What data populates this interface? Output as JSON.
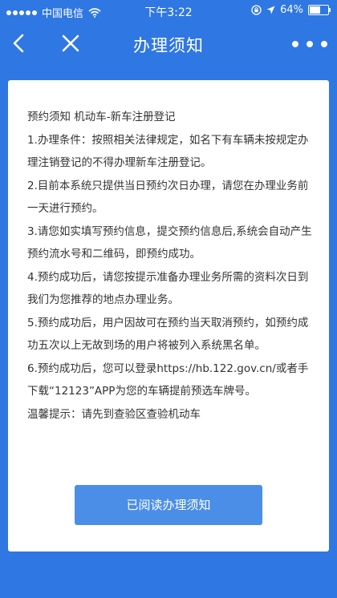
{
  "status_bar": {
    "carrier": "中国电信",
    "time": "下午3:22",
    "battery_percent": "64%",
    "battery_level": 0.64,
    "icons": [
      "signal-dots-icon",
      "wifi-icon",
      "orientation-lock-icon",
      "location-icon",
      "battery-icon"
    ]
  },
  "nav": {
    "title": "办理须知",
    "icons": [
      "back-arrow-icon",
      "close-icon",
      "more-icon"
    ]
  },
  "notice": {
    "heading": "预约须知 机动车-新车注册登记",
    "items": [
      "1.办理条件：按照相关法律规定，如名下有车辆未按规定办理注销登记的不得办理新车注册登记。",
      "2.目前本系统只提供当日预约次日办理，请您在办理业务前一天进行预约。",
      "3.请您如实填写预约信息，提交预约信息后,系统会自动产生预约流水号和二维码，即预约成功。",
      "4.预约成功后，请您按提示准备办理业务所需的资料次日到我们为您推荐的地点办理业务。",
      "5.预约成功后，用户因故可在预约当天取消预约，如预约成功五次以上无故到场的用户将被列入系统黑名单。",
      "6.预约成功后，您可以登录https://hb.122.gov.cn/或者手下载“12123”APP为您的车辆提前预选车牌号。"
    ],
    "reminder": "温馨提示：请先到查验区查验机动车"
  },
  "actions": {
    "confirm_label": "已阅读办理须知"
  },
  "colors": {
    "background": "#2f77e2",
    "button": "#4b8ee8",
    "text": "#333333"
  }
}
